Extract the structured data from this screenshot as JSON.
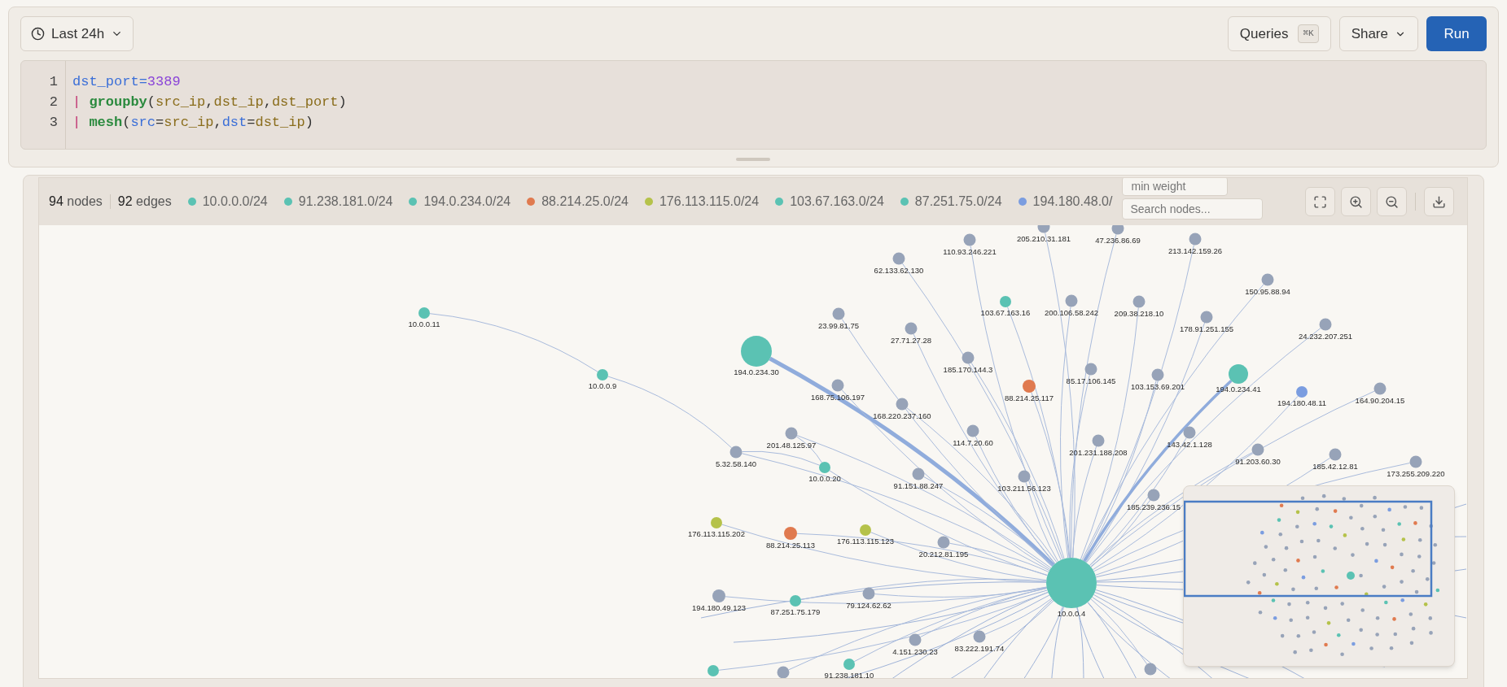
{
  "toolbar": {
    "time_range": "Last 24h",
    "queries": "Queries",
    "queries_shortcut": "⌘K",
    "share": "Share",
    "run": "Run"
  },
  "editor": {
    "lines": [
      {
        "number": "1",
        "tokens": [
          {
            "text": "dst_port",
            "kind": "field"
          },
          {
            "text": "=",
            "kind": "field"
          },
          {
            "text": "3389",
            "kind": "number"
          }
        ]
      },
      {
        "number": "2",
        "tokens": [
          {
            "text": "| ",
            "kind": "pipe"
          },
          {
            "text": "groupby",
            "kind": "func"
          },
          {
            "text": "(",
            "kind": "plain"
          },
          {
            "text": "src_ip",
            "kind": "arg"
          },
          {
            "text": ",",
            "kind": "plain"
          },
          {
            "text": "dst_ip",
            "kind": "arg"
          },
          {
            "text": ",",
            "kind": "plain"
          },
          {
            "text": "dst_port",
            "kind": "arg"
          },
          {
            "text": ")",
            "kind": "plain"
          }
        ]
      },
      {
        "number": "3",
        "tokens": [
          {
            "text": "| ",
            "kind": "pipe"
          },
          {
            "text": "mesh",
            "kind": "func"
          },
          {
            "text": "(",
            "kind": "plain"
          },
          {
            "text": "src",
            "kind": "field"
          },
          {
            "text": "=",
            "kind": "plain"
          },
          {
            "text": "src_ip",
            "kind": "arg"
          },
          {
            "text": ",",
            "kind": "plain"
          },
          {
            "text": "dst",
            "kind": "field"
          },
          {
            "text": "=",
            "kind": "plain"
          },
          {
            "text": "dst_ip",
            "kind": "arg"
          },
          {
            "text": ")",
            "kind": "plain"
          }
        ]
      }
    ]
  },
  "graph": {
    "node_count": "94",
    "node_word": "nodes",
    "edge_count": "92",
    "edge_word": "edges",
    "legend": [
      {
        "label": "10.0.0.0/24",
        "color": "#5bc2b3"
      },
      {
        "label": "91.238.181.0/24",
        "color": "#5bc2b3"
      },
      {
        "label": "194.0.234.0/24",
        "color": "#5bc2b3"
      },
      {
        "label": "88.214.25.0/24",
        "color": "#e07a4f"
      },
      {
        "label": "176.113.115.0/24",
        "color": "#b5c24a"
      },
      {
        "label": "103.67.163.0/24",
        "color": "#5bc2b3"
      },
      {
        "label": "87.251.75.0/24",
        "color": "#5bc2b3"
      },
      {
        "label": "194.180.48.0/",
        "color": "#7b9de0"
      }
    ],
    "min_weight": {
      "placeholder": "min weight"
    },
    "search": {
      "placeholder": "Search nodes..."
    },
    "nodes": [
      {
        "label": "10.0.0.4",
        "color": "#5bc2b3"
      },
      {
        "label": "10.0.0.11",
        "color": "#5bc2b3"
      },
      {
        "label": "10.0.0.9",
        "color": "#5bc2b3"
      },
      {
        "label": "194.0.234.30",
        "color": "#5bc2b3"
      },
      {
        "label": "23.99.81.75",
        "color": "#97a3b8"
      },
      {
        "label": "62.133.62.130",
        "color": "#97a3b8"
      },
      {
        "label": "110.93.246.221",
        "color": "#97a3b8"
      },
      {
        "label": "205.210.31.181",
        "color": "#97a3b8"
      },
      {
        "label": "47.236.86.69",
        "color": "#97a3b8"
      },
      {
        "label": "213.142.159.26",
        "color": "#97a3b8"
      },
      {
        "label": "27.71.27.28",
        "color": "#97a3b8"
      },
      {
        "label": "103.67.163.16",
        "color": "#5bc2b3"
      },
      {
        "label": "200.106.58.242",
        "color": "#97a3b8"
      },
      {
        "label": "209.38.218.10",
        "color": "#97a3b8"
      },
      {
        "label": "150.95.88.94",
        "color": "#97a3b8"
      },
      {
        "label": "178.91.251.155",
        "color": "#97a3b8"
      },
      {
        "label": "24.232.207.251",
        "color": "#97a3b8"
      },
      {
        "label": "185.170.144.3",
        "color": "#97a3b8"
      },
      {
        "label": "168.75.106.197",
        "color": "#97a3b8"
      },
      {
        "label": "88.214.25.117",
        "color": "#e07a4f"
      },
      {
        "label": "85.17.106.145",
        "color": "#97a3b8"
      },
      {
        "label": "103.153.69.201",
        "color": "#97a3b8"
      },
      {
        "label": "194.0.234.41",
        "color": "#5bc2b3"
      },
      {
        "label": "194.180.48.11",
        "color": "#7b9de0"
      },
      {
        "label": "164.90.204.15",
        "color": "#97a3b8"
      },
      {
        "label": "168.220.237.160",
        "color": "#97a3b8"
      },
      {
        "label": "114.7.20.60",
        "color": "#97a3b8"
      },
      {
        "label": "201.48.125.97",
        "color": "#97a3b8"
      },
      {
        "label": "201.231.188.208",
        "color": "#97a3b8"
      },
      {
        "label": "143.42.1.128",
        "color": "#97a3b8"
      },
      {
        "label": "91.203.60.30",
        "color": "#97a3b8"
      },
      {
        "label": "185.42.12.81",
        "color": "#97a3b8"
      },
      {
        "label": "173.255.209.220",
        "color": "#97a3b8"
      },
      {
        "label": "5.32.58.140",
        "color": "#97a3b8"
      },
      {
        "label": "10.0.0.20",
        "color": "#5bc2b3"
      },
      {
        "label": "91.151.88.247",
        "color": "#97a3b8"
      },
      {
        "label": "103.211.56.123",
        "color": "#97a3b8"
      },
      {
        "label": "185.239.236.15",
        "color": "#97a3b8"
      },
      {
        "label": "176.113.115.202",
        "color": "#b5c24a"
      },
      {
        "label": "88.214.25.113",
        "color": "#e07a4f"
      },
      {
        "label": "176.113.115.123",
        "color": "#b5c24a"
      },
      {
        "label": "20.212.81.195",
        "color": "#97a3b8"
      },
      {
        "label": "194.180.49.123",
        "color": "#97a3b8"
      },
      {
        "label": "87.251.75.179",
        "color": "#5bc2b3"
      },
      {
        "label": "79.124.62.62",
        "color": "#97a3b8"
      },
      {
        "label": "4.151.230.23",
        "color": "#97a3b8"
      },
      {
        "label": "83.222.191.74",
        "color": "#97a3b8"
      },
      {
        "label": "91.238.181.10",
        "color": "#5bc2b3"
      },
      {
        "color": "#5bc2b3"
      },
      {
        "color": "#97a3b8"
      },
      {
        "color": "#97a3b8"
      }
    ]
  }
}
